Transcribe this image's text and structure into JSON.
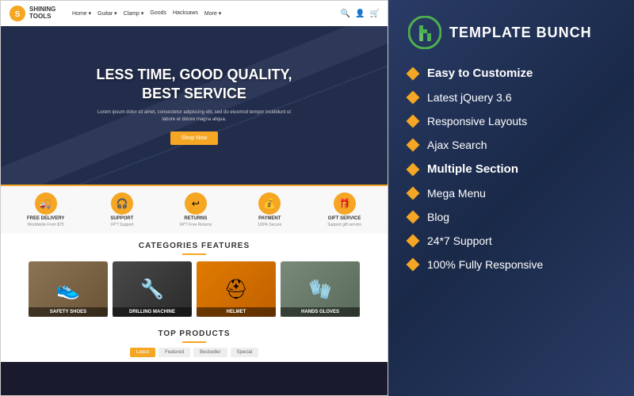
{
  "left": {
    "nav": {
      "logo_name": "SHINING\nTOOLS",
      "links": [
        "Home",
        "Guitar",
        "Clamp",
        "Goods",
        "Hacksaws",
        "More"
      ]
    },
    "hero": {
      "title": "LESS TIME, GOOD QUALITY,\nBEST SERVICE",
      "subtitle": "Lorem ipsum dolor sit amet, consectetur adipiscing elit, sed do eiusmod tempor incididunt ut labore et dolore magna aliqua.",
      "button_label": "Shop Now"
    },
    "features": [
      {
        "icon": "🚚",
        "title": "FREE DELIVERY",
        "sub": "Worldwide From $75"
      },
      {
        "icon": "🎧",
        "title": "SUPPORT",
        "sub": "24*7 Support"
      },
      {
        "icon": "↩",
        "title": "RETURNS",
        "sub": "34*7 Free Returns"
      },
      {
        "icon": "💰",
        "title": "PAYMENT",
        "sub": "100% Secure"
      },
      {
        "icon": "🎁",
        "title": "GIFT SERVICE",
        "sub": "Support gift service"
      }
    ],
    "categories": {
      "section_title": "CATEGORIES FEATURES",
      "items": [
        {
          "label": "SAFETY SHOES",
          "emoji": "👟",
          "class": "cat-shoes"
        },
        {
          "label": "DRILLING MACHINE",
          "emoji": "🔧",
          "class": "cat-drill"
        },
        {
          "label": "HELMET",
          "emoji": "⛑",
          "class": "cat-helmet"
        },
        {
          "label": "HANDS GLOVES",
          "emoji": "🧤",
          "class": "cat-gloves"
        }
      ]
    },
    "products": {
      "section_title": "TOP PRODUCTS",
      "tabs": [
        {
          "label": "Latest",
          "active": true
        },
        {
          "label": "Featured",
          "active": false
        },
        {
          "label": "Bestseller",
          "active": false
        },
        {
          "label": "Special",
          "active": false
        }
      ]
    }
  },
  "right": {
    "brand": {
      "name": "TEMPLATE BUNCH"
    },
    "features": [
      {
        "label": "Easy to Customize",
        "highlight": true
      },
      {
        "label": "Latest jQuery 3.6",
        "highlight": false
      },
      {
        "label": "Responsive Layouts",
        "highlight": false
      },
      {
        "label": "Ajax Search",
        "highlight": false
      },
      {
        "label": "Multiple Section",
        "highlight": true
      },
      {
        "label": "Mega Menu",
        "highlight": false
      },
      {
        "label": "Blog",
        "highlight": false
      },
      {
        "label": "24*7 Support",
        "highlight": false
      },
      {
        "label": "100% Fully Responsive",
        "highlight": false
      }
    ]
  }
}
